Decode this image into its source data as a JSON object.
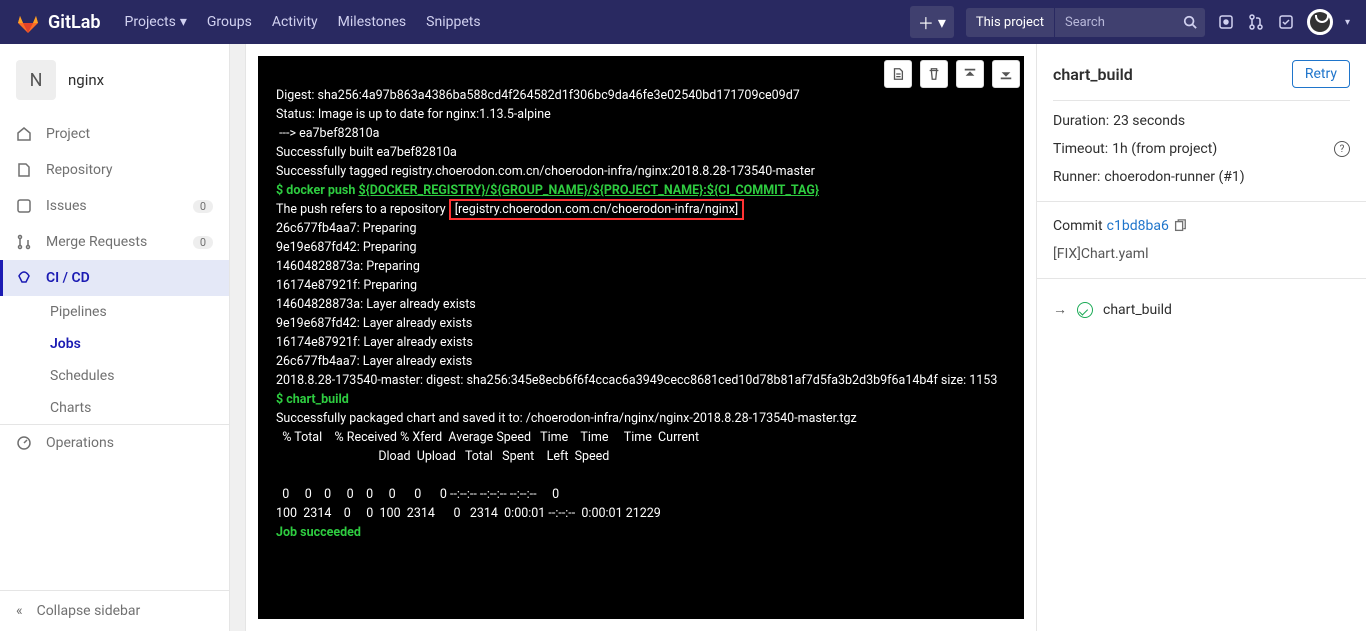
{
  "top": {
    "brand": "GitLab",
    "nav": [
      "Projects",
      "Groups",
      "Activity",
      "Milestones",
      "Snippets"
    ],
    "search_scope": "This project",
    "search_placeholder": "Search"
  },
  "project": {
    "initial": "N",
    "name": "nginx"
  },
  "sidebar": {
    "items": [
      {
        "label": "Project"
      },
      {
        "label": "Repository"
      },
      {
        "label": "Issues",
        "badge": "0"
      },
      {
        "label": "Merge Requests",
        "badge": "0"
      },
      {
        "label": "CI / CD"
      },
      {
        "label": "Operations"
      }
    ],
    "ci_sub": [
      "Pipelines",
      "Jobs",
      "Schedules",
      "Charts"
    ],
    "collapse": "Collapse sidebar"
  },
  "log": {
    "lines": [
      {
        "t": "Digest: sha256:4a97b863a4386ba588cd4f264582d1f306bc9da46fe3e02540bd171709ce09d7"
      },
      {
        "t": "Status: Image is up to date for nginx:1.13.5-alpine"
      },
      {
        "t": " ---> ea7bef82810a"
      },
      {
        "t": "Successfully built ea7bef82810a"
      },
      {
        "t": "Successfully tagged registry.choerodon.com.cn/choerodon-infra/nginx:2018.8.28-173540-master"
      },
      {
        "cls": "cmd",
        "prefix": "$ ",
        "body": "docker push ",
        "u": "${DOCKER_REGISTRY}/${GROUP_NAME}/${PROJECT_NAME}:${CI_COMMIT_TAG}"
      },
      {
        "cls": "split",
        "a": "The push refers to a repository ",
        "b": "[registry.choerodon.com.cn/choerodon-infra/nginx]"
      },
      {
        "t": "26c677fb4aa7: Preparing"
      },
      {
        "t": "9e19e687fd42: Preparing"
      },
      {
        "t": "14604828873a: Preparing"
      },
      {
        "t": "16174e87921f: Preparing"
      },
      {
        "t": "14604828873a: Layer already exists"
      },
      {
        "t": "9e19e687fd42: Layer already exists"
      },
      {
        "t": "16174e87921f: Layer already exists"
      },
      {
        "t": "26c677fb4aa7: Layer already exists"
      },
      {
        "t": "2018.8.28-173540-master: digest: sha256:345e8ecb6f6f4ccac6a3949cecc8681ced10d78b81af7d5fa3b2d3b9f6a14b4f size: 1153"
      },
      {
        "cls": "green",
        "t": "$ chart_build"
      },
      {
        "t": "Successfully packaged chart and saved it to: /choerodon-infra/nginx/nginx-2018.8.28-173540-master.tgz"
      },
      {
        "t": "  % Total    % Received % Xferd  Average Speed   Time    Time     Time  Current"
      },
      {
        "t": "                                 Dload  Upload   Total   Spent    Left  Speed"
      },
      {
        "t": ""
      },
      {
        "t": "  0     0    0     0    0     0      0      0 --:--:-- --:--:-- --:--:--     0"
      },
      {
        "t": "100  2314    0     0  100  2314      0   2314  0:00:01 --:--:--  0:00:01 21229"
      },
      {
        "cls": "green",
        "t": "Job succeeded"
      }
    ]
  },
  "right": {
    "title": "chart_build",
    "retry": "Retry",
    "duration_label": "Duration:",
    "duration": "23 seconds",
    "timeout_label": "Timeout:",
    "timeout": "1h (from project)",
    "runner_label": "Runner:",
    "runner": "choerodon-runner (#1)",
    "commit_label": "Commit",
    "commit_sha": "c1bd8ba6",
    "commit_msg": "[FIX]Chart.yaml",
    "stage": "chart_build"
  }
}
